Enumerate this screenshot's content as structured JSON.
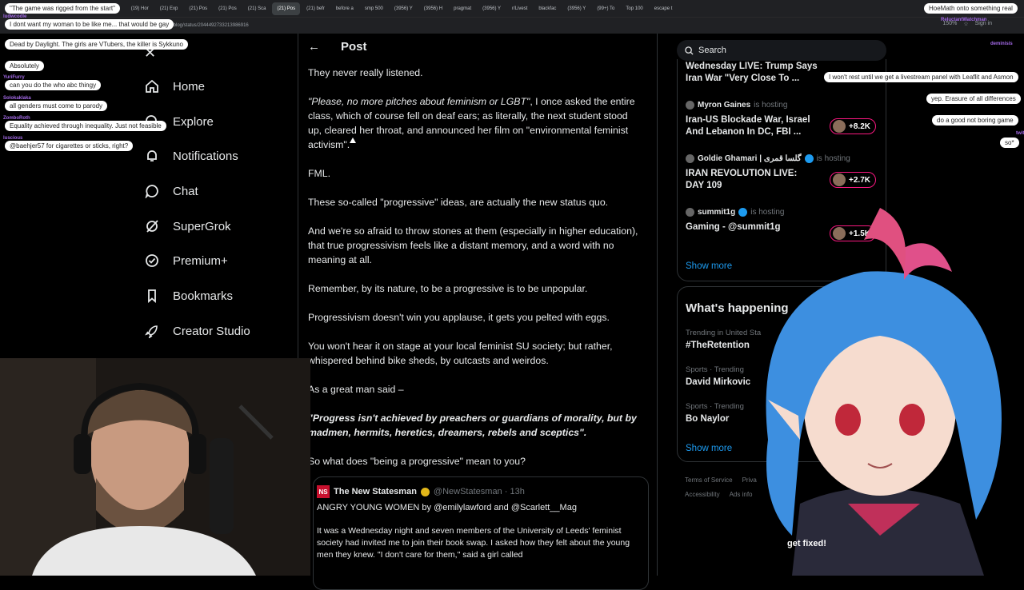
{
  "browser": {
    "tabs": [
      "\"The game was rigged from the start\"",
      "(3956) H",
      "(19) blo",
      "(19) Hor",
      "(21) Exp",
      "(21) Pos",
      "(21) Pos",
      "(21) Sca",
      "(21) Pos",
      "(21) befr",
      "before a",
      "smp 500",
      "(3956) Y",
      "(3956) H",
      "pragmat",
      "(3956) Y",
      "r/Livest",
      "blackfac",
      "(3956) Y",
      "(99+) To",
      "Top 100",
      "escape t"
    ],
    "active_tab_index": 8,
    "url": "/blog/status/2044492733213986916",
    "zoom": "150%",
    "signin": "Sign in"
  },
  "nav": {
    "items": [
      {
        "label": "Home",
        "icon": "home-icon"
      },
      {
        "label": "Explore",
        "icon": "search-icon"
      },
      {
        "label": "Notifications",
        "icon": "bell-icon"
      },
      {
        "label": "Chat",
        "icon": "chat-icon"
      },
      {
        "label": "SuperGrok",
        "icon": "grok-icon"
      },
      {
        "label": "Premium+",
        "icon": "verified-icon"
      },
      {
        "label": "Bookmarks",
        "icon": "bookmark-icon"
      },
      {
        "label": "Creator Studio",
        "icon": "rocket-icon"
      }
    ]
  },
  "post": {
    "header": "Post",
    "p1": "They never really listened.",
    "p2_italic": "\"Please, no more pitches about feminism or LGBT\"",
    "p2_rest": ", I once asked the entire class, which of course fell on deaf ears; as literally, the next student stood up, cleared her throat, and announced her film on \"environmental feminist activism\".",
    "p3": "FML.",
    "p4": "These so-called \"progressive\" ideas, are actually the new status quo.",
    "p5": "And we're so afraid to throw stones at them (especially in higher education), that true progressivism feels like a distant memory, and a word with no meaning at all.",
    "p6": "Remember, by its nature, to be a progressive is to be unpopular.",
    "p7": "Progressivism doesn't win you applause, it gets you pelted with eggs.",
    "p8": "You won't hear it on stage at your local feminist SU society; but rather, whispered behind bike sheds, by outcasts and weirdos.",
    "p9": "As a great man said –",
    "p10": "\"Progress isn't achieved by preachers or guardians of morality, but by madmen, hermits, heretics, dreamers, rebels and sceptics\".",
    "p11": "So what does \"being a progressive\" mean to you?",
    "quote": {
      "logo": "NS",
      "name": "The New Statesman",
      "handle": "@NewStatesman · 13h",
      "line1": "ANGRY YOUNG WOMEN by @emilylawford and @Scarlett__Mag",
      "body": "It was a Wednesday night and seven members of the University of Leeds' feminist society had invited me to join their book swap. I asked how they felt about the young men they knew. \"I don't care for them,\" said a girl called"
    }
  },
  "sidebar": {
    "search_placeholder": "Search",
    "live": [
      {
        "host": "",
        "hosting": "",
        "title": "Wednesday LIVE: Trump Says Iran War \"Very Close To ...",
        "viewers": ""
      },
      {
        "host": "Myron Gaines",
        "hosting": "is hosting",
        "title": "Iran-US Blockade War, Israel And Lebanon In DC, FBI ...",
        "viewers": "+8.2K"
      },
      {
        "host": "Goldie Ghamari | گلسا قمری",
        "hosting": "is hosting",
        "title": "IRAN REVOLUTION LIVE: DAY 109",
        "viewers": "+2.7K"
      },
      {
        "host": "summit1g",
        "hosting": "is hosting",
        "title": "Gaming - @summit1g",
        "viewers": "+1.5K"
      }
    ],
    "show_more": "Show more",
    "whats_happening": "What's happening",
    "trends": [
      {
        "meta": "Trending in United Sta",
        "name": "#TheRetention"
      },
      {
        "meta": "Sports · Trending",
        "name": "David Mirkovic"
      },
      {
        "meta": "Sports · Trending",
        "name": "Bo Naylor"
      }
    ],
    "show_more2": "Show more",
    "footer1": [
      "Terms of Service",
      "Priva"
    ],
    "footer2": [
      "Accessibility",
      "Ads info"
    ]
  },
  "stream_chat_left": [
    {
      "name": "",
      "msg": "\"The game was rigged from the start\""
    },
    {
      "name": "ludwcodle",
      "msg": "I dont want my woman to be like me... that would be gay"
    },
    {
      "name": "",
      "msg": "Dead by Daylight. The girls are VTubers, the killer is Sykkuno"
    },
    {
      "name": "",
      "msg": "Absolutely"
    },
    {
      "name": "YuriFurry",
      "msg": "can you do the who abc thingy"
    },
    {
      "name": "Solokaklaka",
      "msg": "all genders must come to parody"
    },
    {
      "name": "ZomboRoth",
      "msg": "Equality achieved through inequality. Just not feasible"
    },
    {
      "name": "luscious",
      "msg": "@baehjer57 for cigarettes or sticks, right?"
    }
  ],
  "stream_chat_right": [
    {
      "name": "",
      "msg": "HoeMath onto something real"
    },
    {
      "name": "ReluctantWatchman",
      "msg": ""
    },
    {
      "name": "deminisis",
      "msg": ""
    },
    {
      "name": "",
      "msg": "I won't rest until we get a livestream panel with Leaflit and Asmon"
    },
    {
      "name": "",
      "msg": "yep. Erasure of all differences"
    },
    {
      "name": "",
      "msg": "do a good not boring game"
    },
    {
      "name": "twitch_adeedy",
      "msg": "so*"
    }
  ],
  "overlay_text": "get fixed!"
}
